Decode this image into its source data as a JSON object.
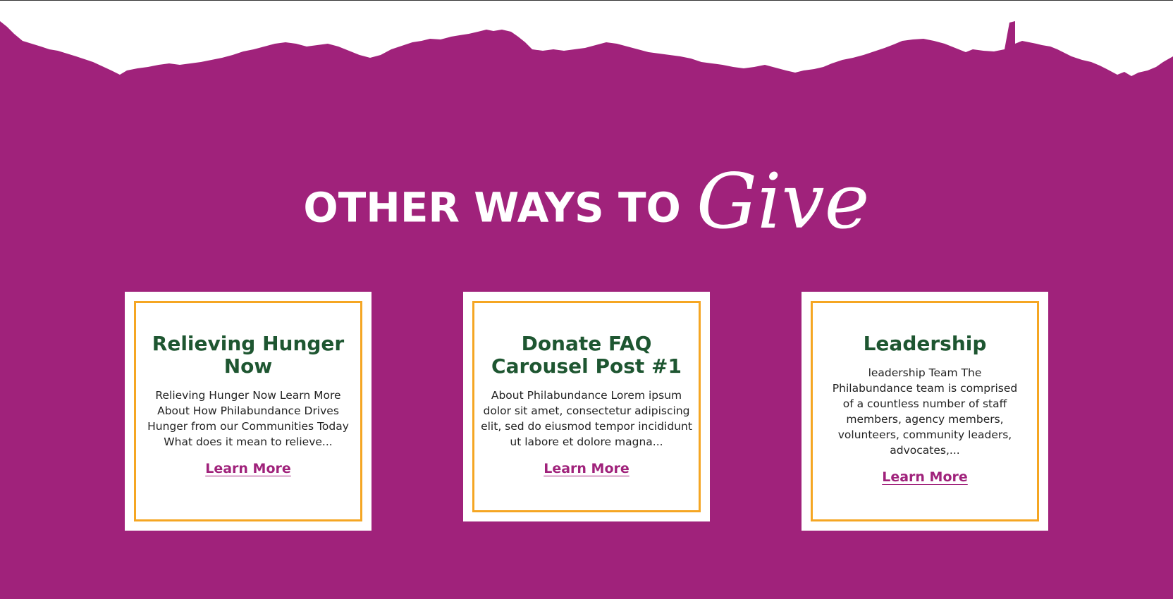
{
  "colors": {
    "background": "#a0227b",
    "card_border": "#f5a623",
    "title_green": "#1e5631",
    "link_purple": "#a0227b"
  },
  "heading": {
    "main": "OTHER WAYS TO",
    "script": "Give"
  },
  "cards": [
    {
      "title": "Relieving Hunger Now",
      "text": "Relieving Hunger Now Learn More About How Philabundance Drives Hunger from our Communities Today What does it mean to relieve...",
      "link": "Learn More"
    },
    {
      "title": "Donate FAQ Carousel Post #1",
      "text": "About Philabundance Lorem ipsum dolor sit amet, consectetur adipiscing elit, sed do eiusmod tempor incididunt ut labore et dolore magna...",
      "link": "Learn More"
    },
    {
      "title": "Leadership",
      "text": "leadership Team The Philabundance team is comprised of a countless number of staff members, agency members, volunteers, community leaders, advocates,...",
      "link": "Learn More"
    }
  ]
}
